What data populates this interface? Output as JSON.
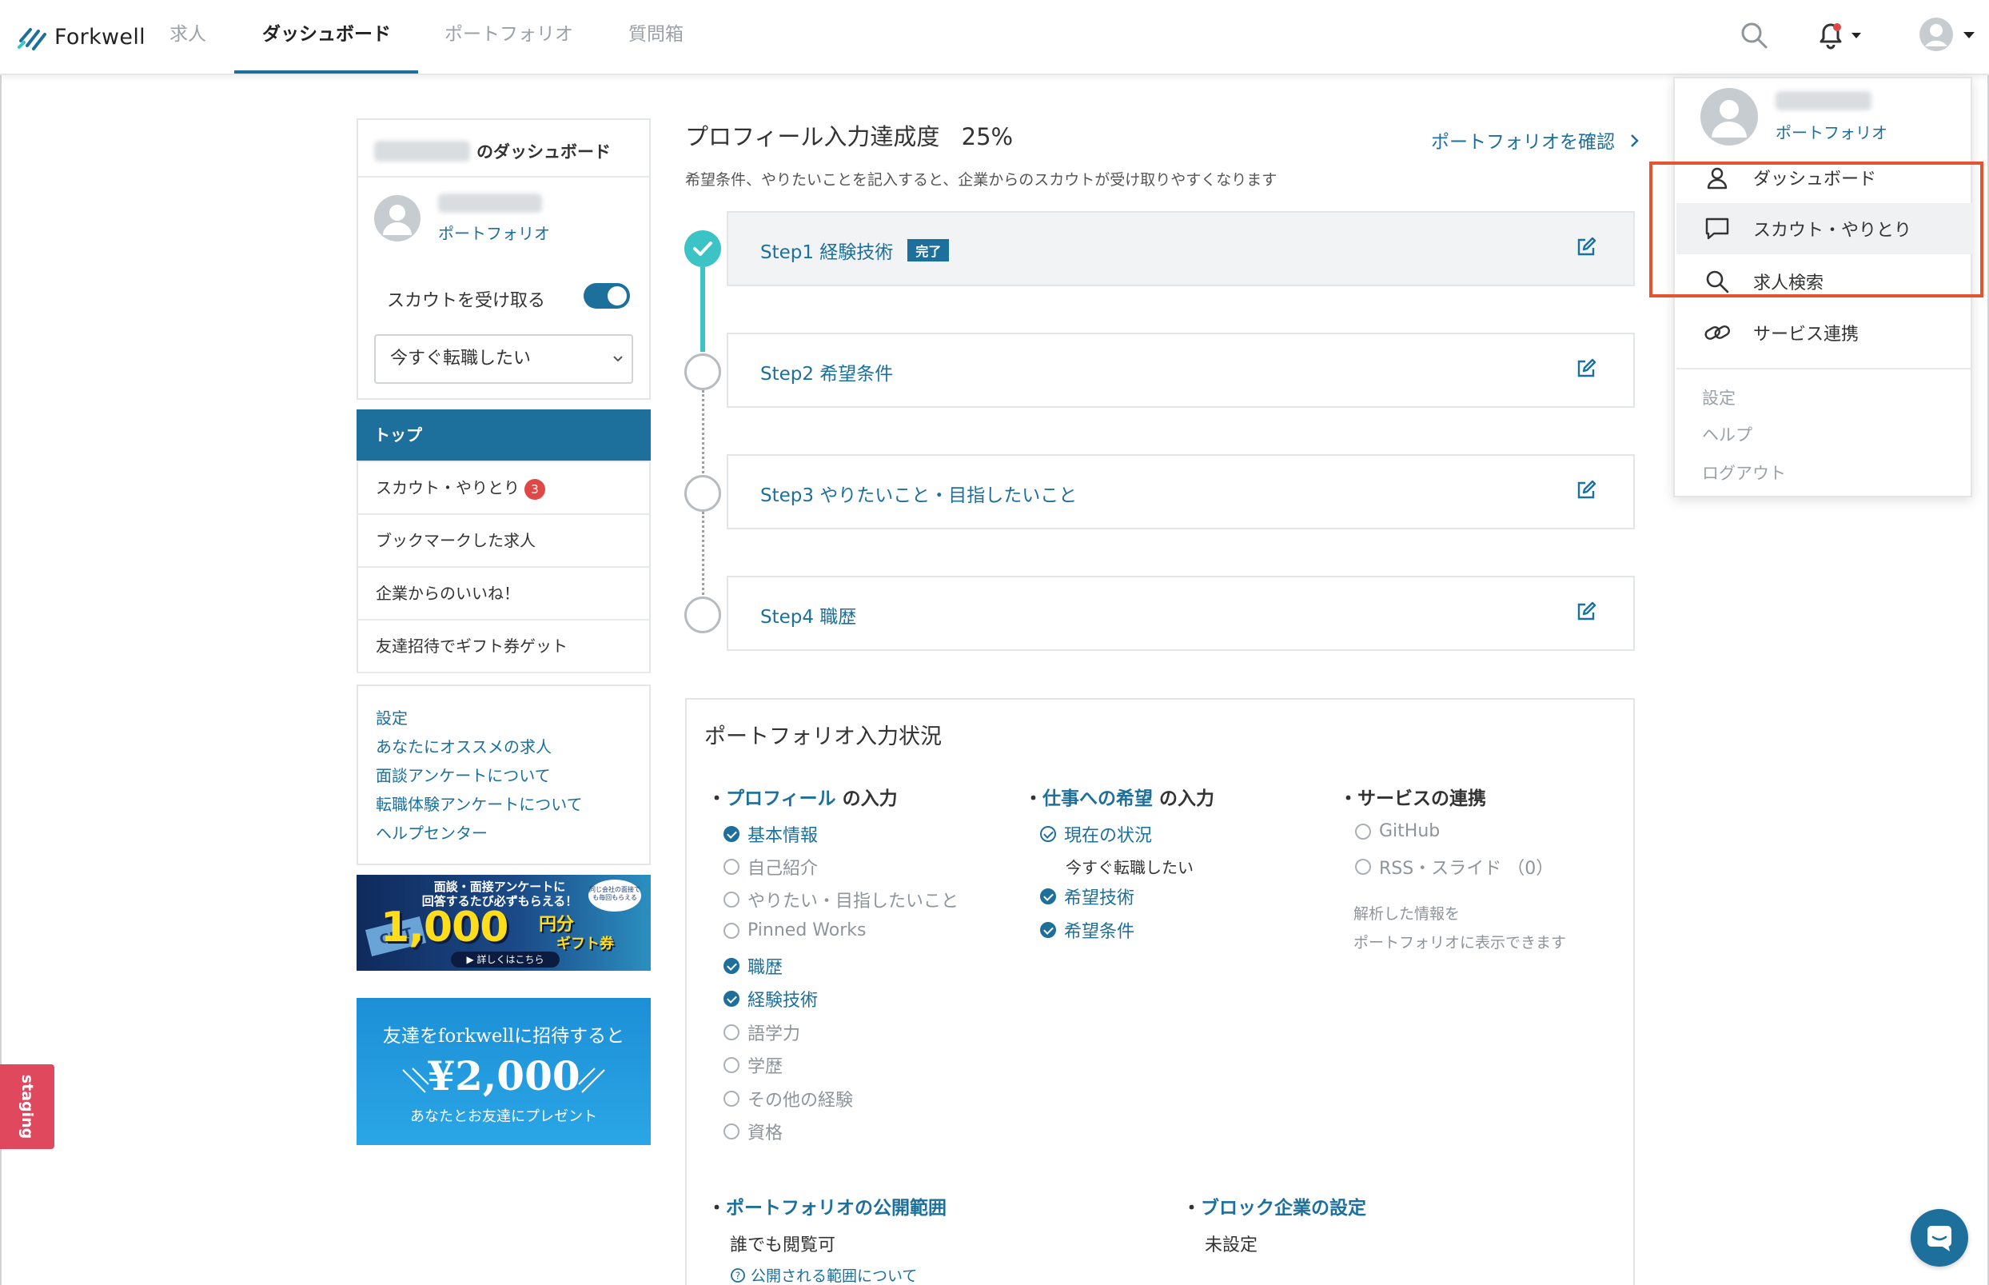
{
  "header": {
    "logo_text": "Forkwell",
    "nav": [
      "求人",
      "ダッシュボード",
      "ポートフォリオ",
      "質問箱"
    ]
  },
  "sidebar": {
    "dashboard_suffix": "のダッシュボード",
    "portfolio_link": "ポートフォリオ",
    "scout_label": "スカウトを受け取る",
    "status_select": "今すぐ転職したい",
    "menu": [
      {
        "label": "トップ",
        "active": true
      },
      {
        "label": "スカウト・やりとり",
        "badge": "3"
      },
      {
        "label": "ブックマークした求人"
      },
      {
        "label": "企業からのいいね！"
      },
      {
        "label": "友達招待でギフト券ゲット"
      }
    ],
    "links": [
      "設定",
      "あなたにオススメの求人",
      "面談アンケートについて",
      "転職体験アンケートについて",
      "ヘルプセンター"
    ],
    "banner1": {
      "line1": "面談・面接アンケートに",
      "line2": "回答するたび必ずもらえる！",
      "amount": "1,000",
      "unit": "円分",
      "unit2": "ギフト券",
      "cta": "▶ 詳しくはこちら",
      "gift": "GIFT",
      "corner": "同じ会社の面接でも毎回もらえる"
    },
    "banner2": {
      "line1": "友達をforkwellに招待すると",
      "amount": "¥2,000",
      "line2": "あなたとお友達にプレゼント"
    }
  },
  "main": {
    "title": "プロフィール入力達成度",
    "percent": "25%",
    "subtitle": "希望条件、やりたいことを記入すると、企業からのスカウトが受け取りやすくなります",
    "portfolio_check_link": "ポートフォリオを確認",
    "steps": [
      {
        "label": "Step1 経験技術",
        "tag": "完了",
        "done": true
      },
      {
        "label": "Step2 希望条件",
        "done": false
      },
      {
        "label": "Step3 やりたいこと・目指したいこと",
        "done": false
      },
      {
        "label": "Step4 職歴",
        "done": false
      }
    ]
  },
  "status": {
    "title": "ポートフォリオ入力状況",
    "col1_head_hl": "プロフィール",
    "col1_head_rest": "の入力",
    "col1_items": [
      {
        "label": "基本情報",
        "state": "on"
      },
      {
        "label": "自己紹介",
        "state": "off"
      },
      {
        "label": "やりたい・目指したいこと",
        "state": "off"
      },
      {
        "label": "Pinned Works",
        "state": "off"
      },
      {
        "label": "職歴",
        "state": "on"
      },
      {
        "label": "経験技術",
        "state": "on"
      },
      {
        "label": "語学力",
        "state": "off"
      },
      {
        "label": "学歴",
        "state": "off"
      },
      {
        "label": "その他の経験",
        "state": "off"
      },
      {
        "label": "資格",
        "state": "off"
      }
    ],
    "col2_head_hl": "仕事への希望",
    "col2_head_rest": "の入力",
    "col2_current_label": "現在の状況",
    "col2_current_value": "今すぐ転職したい",
    "col2_items": [
      {
        "label": "希望技術",
        "state": "on"
      },
      {
        "label": "希望条件",
        "state": "on"
      }
    ],
    "col3_head": "サービスの連携",
    "col3_items": [
      {
        "label": "GitHub",
        "state": "off"
      },
      {
        "label": "RSS・スライド （0）",
        "state": "off"
      }
    ],
    "col3_note1": "解析した情報を",
    "col3_note2": "ポートフォリオに表示できます",
    "visibility_head": "ポートフォリオの公開範囲",
    "visibility_value": "誰でも閲覧可",
    "visibility_link": "公開される範囲について",
    "block_head": "ブロック企業の設定",
    "block_value": "未設定"
  },
  "dropdown": {
    "portfolio_link": "ポートフォリオ",
    "items": [
      "ダッシュボード",
      "スカウト・やりとり",
      "求人検索",
      "サービス連携"
    ],
    "small": [
      "設定",
      "ヘルプ",
      "ログアウト"
    ]
  },
  "staging_label": "staging",
  "colors": {
    "accent": "#1d6f9c",
    "teal": "#3cc3c6",
    "highlight": "#e4552f",
    "badge": "#e04848"
  }
}
